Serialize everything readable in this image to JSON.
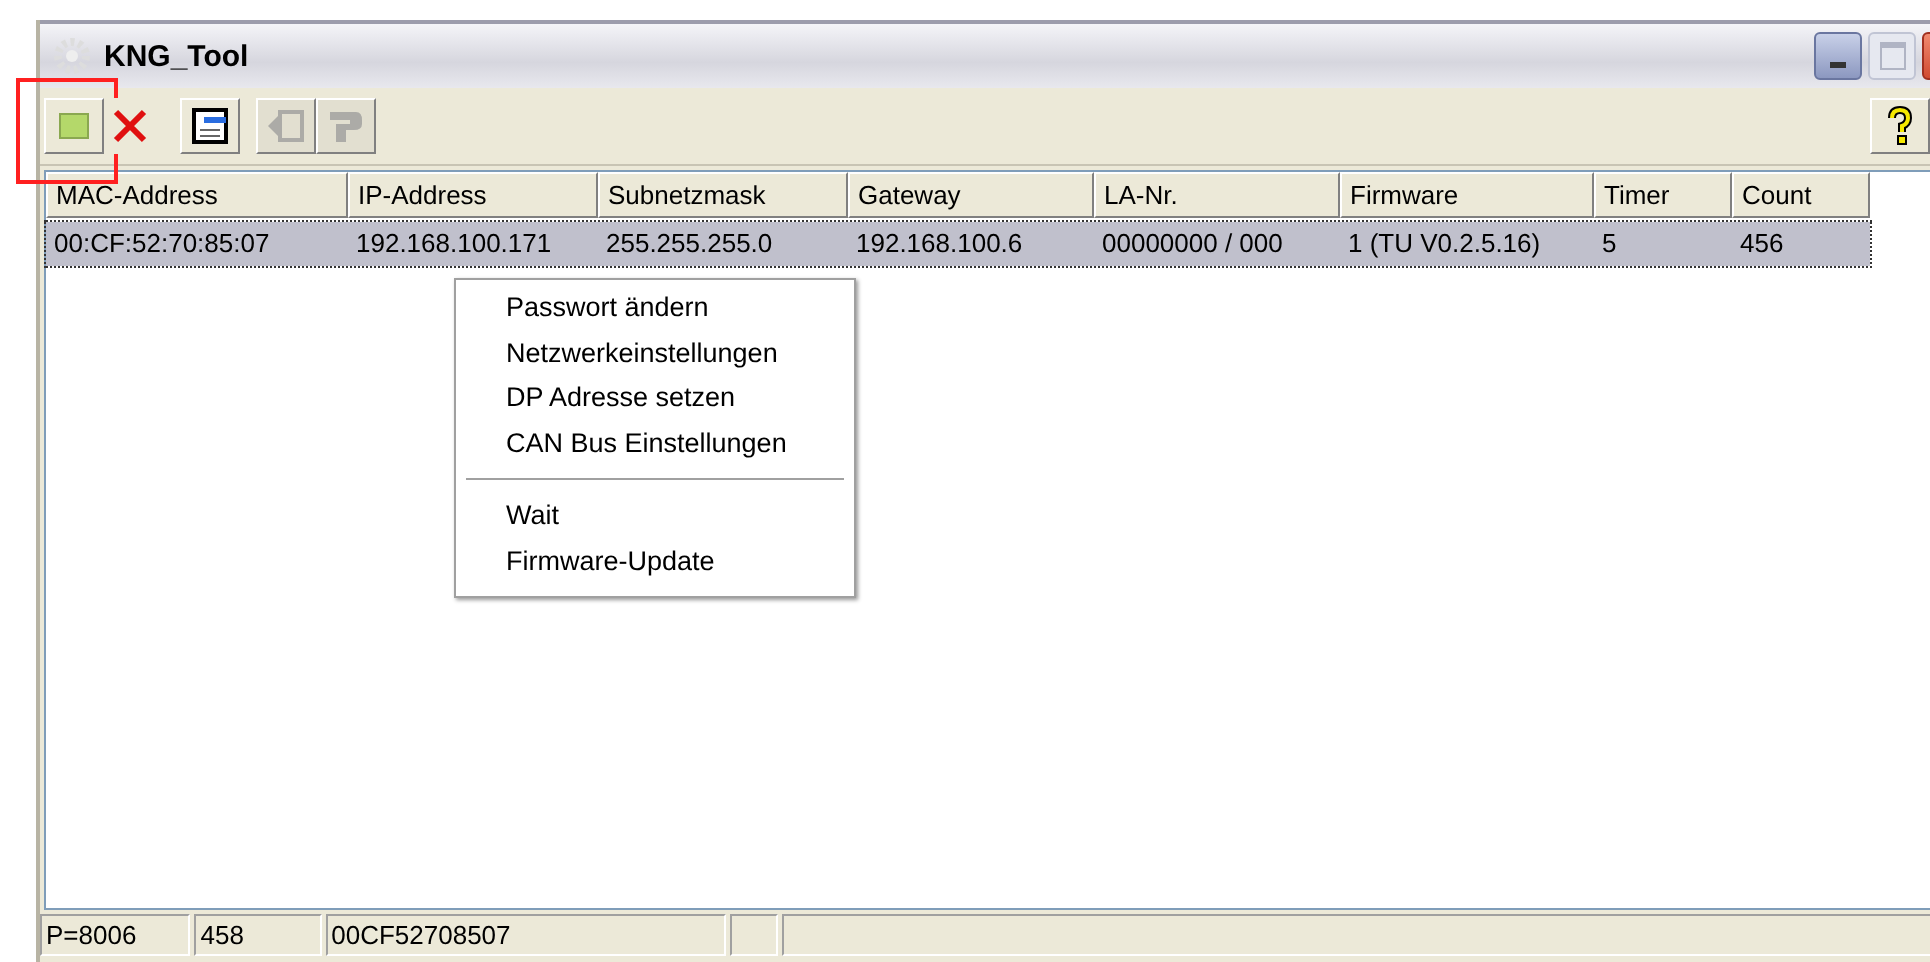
{
  "window": {
    "title": "KNG_Tool"
  },
  "toolbar": [
    {
      "kind": "connect",
      "disabled": false,
      "highlighted": true
    },
    {
      "kind": "delete",
      "disabled": false,
      "highlighted": false
    },
    {
      "kind": "settings",
      "disabled": false,
      "highlighted": false
    },
    {
      "kind": "transfer",
      "disabled": true,
      "highlighted": false
    },
    {
      "kind": "tool",
      "disabled": true,
      "highlighted": false
    }
  ],
  "table": {
    "columns": [
      "MAC-Address",
      "IP-Address",
      "Subnetzmask",
      "Gateway",
      "LA-Nr.",
      "Firmware",
      "Timer",
      "Count"
    ],
    "rows": [
      {
        "selected": true,
        "cells": [
          "00:CF:52:70:85:07",
          "192.168.100.171",
          "255.255.255.0",
          "192.168.100.6",
          "00000000 / 000",
          "1 (TU V0.2.5.16)",
          "5",
          "456"
        ]
      }
    ]
  },
  "context_menu": [
    {
      "kind": "item",
      "label": "Passwort ändern"
    },
    {
      "kind": "item",
      "label": "Netzwerkeinstellungen"
    },
    {
      "kind": "item",
      "label": "DP Adresse setzen"
    },
    {
      "kind": "item",
      "label": "CAN Bus Einstellungen"
    },
    {
      "kind": "separator"
    },
    {
      "kind": "item",
      "label": "Wait"
    },
    {
      "kind": "item",
      "label": "Firmware-Update"
    }
  ],
  "status_bar": [
    "P=8006",
    "458",
    "00CF52708507"
  ]
}
